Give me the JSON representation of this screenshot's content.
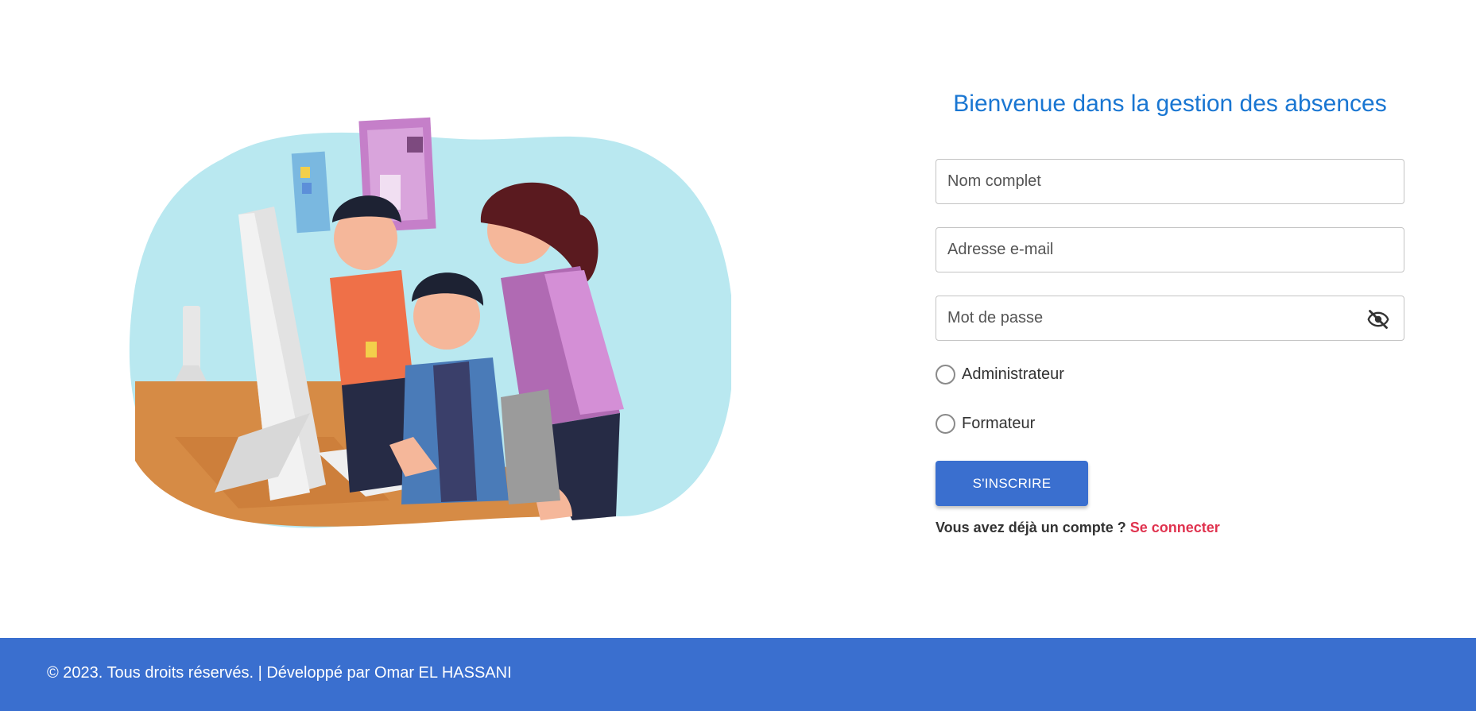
{
  "form": {
    "title": "Bienvenue dans la gestion des absences",
    "fields": {
      "full_name_placeholder": "Nom complet",
      "email_placeholder": "Adresse e-mail",
      "password_placeholder": "Mot de passe"
    },
    "roles": [
      {
        "label": "Administrateur",
        "selected": false
      },
      {
        "label": "Formateur",
        "selected": false
      }
    ],
    "submit_label": "S'INSCRIRE",
    "signin_prompt": "Vous avez déjà un compte ?",
    "signin_link": "Se connecter"
  },
  "footer": {
    "text": "© 2023. Tous droits réservés. | Développé par Omar EL HASSANI"
  },
  "icons": {
    "password_toggle": "eye-off-icon"
  },
  "colors": {
    "accent": "#3a6fcf",
    "title": "#1976d2",
    "link": "#e0334f"
  }
}
